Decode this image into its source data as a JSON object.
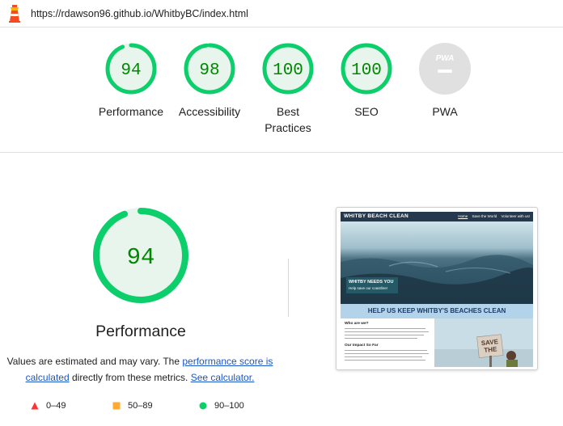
{
  "url": "https://rdawson96.github.io/WhitbyBC/index.html",
  "colors": {
    "pass": "#0cce6b",
    "pass_text": "#008800",
    "pass_fill": "#e8f5ec",
    "gray": "#e0e0e0",
    "fail": "#ff3333",
    "average": "#ffaa33",
    "link": "#1a56c8"
  },
  "summary": [
    {
      "score": "94",
      "label": "Performance",
      "value": 0.94
    },
    {
      "score": "98",
      "label": "Accessibility",
      "value": 0.98
    },
    {
      "score": "100",
      "label": "Best Practices",
      "value": 1.0
    },
    {
      "score": "100",
      "label": "SEO",
      "value": 1.0
    },
    {
      "badge": "PWA",
      "label": "PWA"
    }
  ],
  "main": {
    "score": "94",
    "value": 0.94,
    "title": "Performance",
    "note_prefix": "Values are estimated and may vary. The ",
    "note_link1": "performance score is calculated",
    "note_middle": " directly from these metrics. ",
    "note_link2": "See calculator."
  },
  "legend": [
    {
      "range": "0–49",
      "icon": "triangle"
    },
    {
      "range": "50–89",
      "icon": "square"
    },
    {
      "range": "90–100",
      "icon": "circle"
    }
  ],
  "screenshot": {
    "brand": "WHITBY BEACH CLEAN",
    "nav": [
      "Home",
      "Save the World",
      "Volunteer with us!"
    ],
    "hero_title": "WHITBY NEEDS YOU",
    "hero_subtitle": "Help save our coastline!",
    "banner": "HELP US KEEP WHITBY'S BEACHES CLEAN",
    "section1": "Who are we?",
    "section2": "Our Impact So Far",
    "sign": "SAVE THE"
  }
}
